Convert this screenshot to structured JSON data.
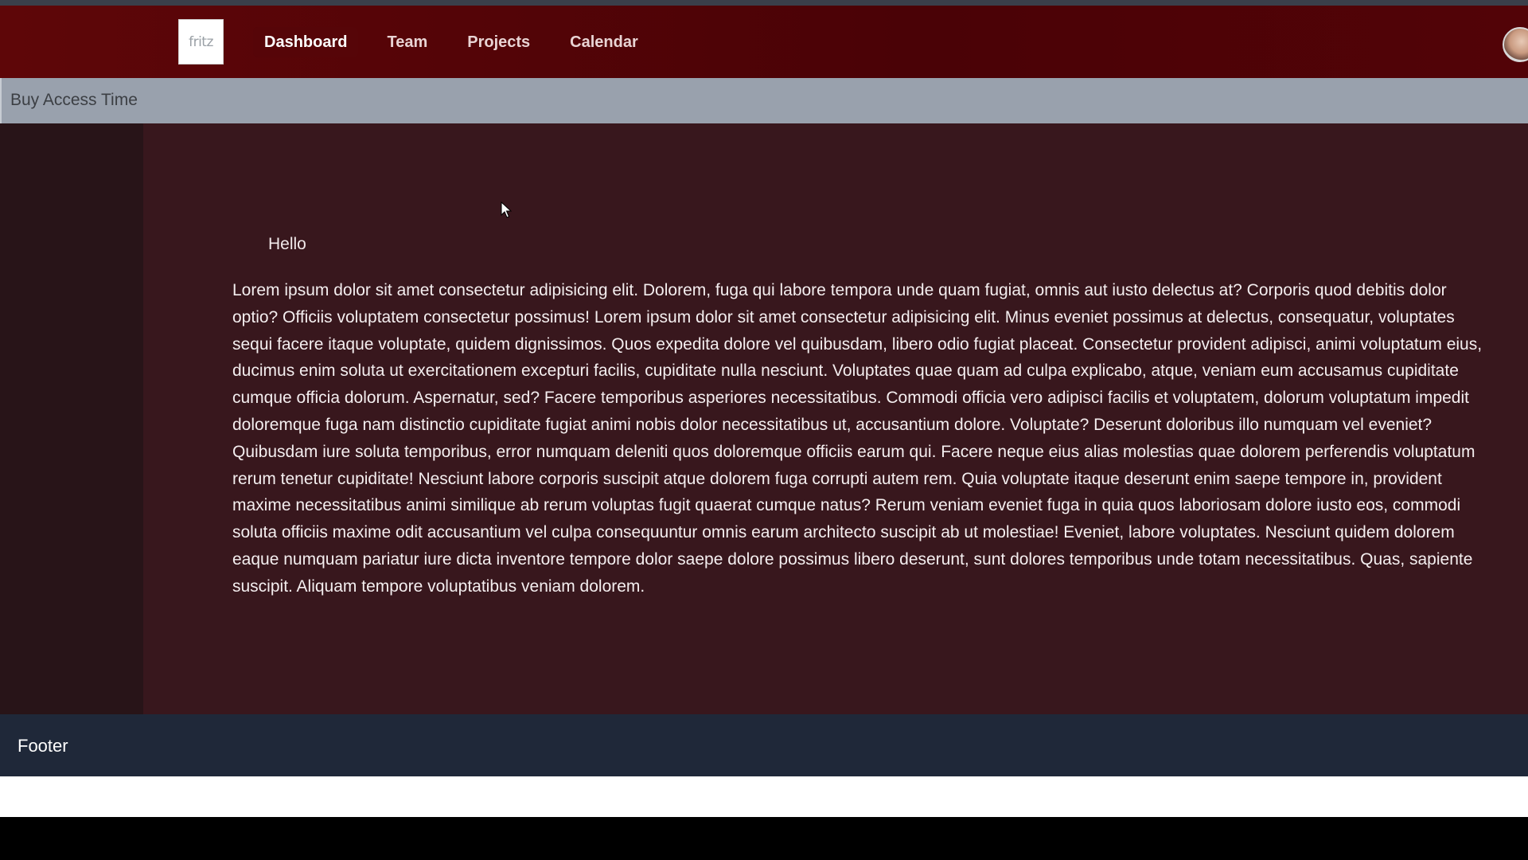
{
  "nav": {
    "logo_text": "fritz",
    "links": [
      {
        "label": "Dashboard",
        "active": true
      },
      {
        "label": "Team",
        "active": false
      },
      {
        "label": "Projects",
        "active": false
      },
      {
        "label": "Calendar",
        "active": false
      }
    ],
    "avatar_icon": "user-avatar-icon"
  },
  "subheader": {
    "title": "Buy Access Time"
  },
  "main": {
    "greeting": "Hello",
    "body": "Lorem ipsum dolor sit amet consectetur adipisicing elit. Dolorem, fuga qui labore tempora unde quam fugiat, omnis aut iusto delectus at? Corporis quod debitis dolor optio? Officiis voluptatem consectetur possimus! Lorem ipsum dolor sit amet consectetur adipisicing elit. Minus eveniet possimus at delectus, consequatur, voluptates sequi facere itaque voluptate, quidem dignissimos. Quos expedita dolore vel quibusdam, libero odio fugiat placeat. Consectetur provident adipisci, animi voluptatum eius, ducimus enim soluta ut exercitationem excepturi facilis, cupiditate nulla nesciunt. Voluptates quae quam ad culpa explicabo, atque, veniam eum accusamus cupiditate cumque officia dolorum. Aspernatur, sed? Facere temporibus asperiores necessitatibus. Commodi officia vero adipisci facilis et voluptatem, dolorum voluptatum impedit doloremque fuga nam distinctio cupiditate fugiat animi nobis dolor necessitatibus ut, accusantium dolore. Voluptate? Deserunt doloribus illo numquam vel eveniet? Quibusdam iure soluta temporibus, error numquam deleniti quos doloremque officiis earum qui. Facere neque eius alias molestias quae dolorem perferendis voluptatum rerum tenetur cupiditate! Nesciunt labore corporis suscipit atque dolorem fuga corrupti autem rem. Quia voluptate itaque deserunt enim saepe tempore in, provident maxime necessitatibus animi similique ab rerum voluptas fugit quaerat cumque natus? Rerum veniam eveniet fuga in quia quos laboriosam dolore iusto eos, commodi soluta officiis maxime odit accusantium vel culpa consequuntur omnis earum architecto suscipit ab ut molestiae! Eveniet, labore voluptates. Nesciunt quidem dolorem eaque numquam pariatur iure dicta inventore tempore dolor saepe dolore possimus libero deserunt, sunt dolores temporibus unde totam necessitatibus. Quas, sapiente suscipit. Aliquam tempore voluptatibus veniam dolorem."
  },
  "footer": {
    "text": "Footer"
  },
  "colors": {
    "navbar": "#4a0206",
    "subheader": "#99a1ad",
    "sidebar": "#281418",
    "main": "#38171d",
    "footer": "#1f2839"
  }
}
